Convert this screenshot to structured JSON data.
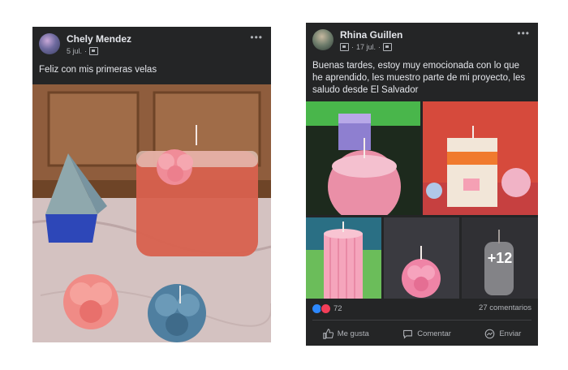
{
  "post1": {
    "author": "Chely Mendez",
    "date": "5 jul.",
    "caption": "Feliz con mis primeras velas",
    "more": "•••"
  },
  "post2": {
    "author": "Rhina Guillen",
    "date": "17 jul.",
    "caption": "Buenas tardes, estoy muy emocionada con lo que he aprendido, les muestro parte de mi proyecto, les saludo desde El Salvador",
    "more": "•••",
    "more_photos": "+12",
    "reactions_count": "72",
    "comments": "27 comentarios",
    "actions": {
      "like": "Me gusta",
      "comment": "Comentar",
      "share": "Enviar"
    }
  },
  "colors": {
    "card": "#242526",
    "text": "#e4e6eb",
    "muted": "#b0b3b8",
    "like": "#2d88ff",
    "love": "#f33e58"
  }
}
